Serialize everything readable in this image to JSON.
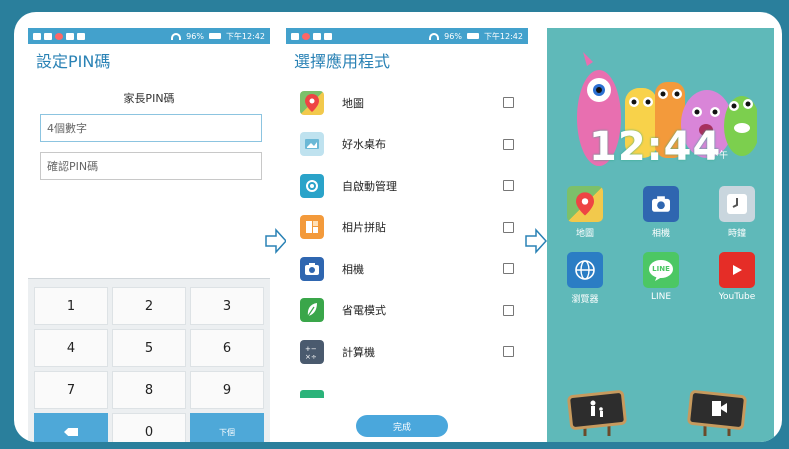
{
  "status_bar": {
    "battery": "96%",
    "time": "下午12:42"
  },
  "pin_screen": {
    "title": "設定PIN碼",
    "subtitle": "家長PIN碼",
    "pin_placeholder": "4個數字",
    "confirm_placeholder": "確認PIN碼",
    "keys": [
      "1",
      "2",
      "3",
      "4",
      "5",
      "6",
      "7",
      "8",
      "9",
      "",
      "0",
      "下個"
    ]
  },
  "app_select_screen": {
    "title": "選擇應用程式",
    "apps": [
      {
        "name": "地圖",
        "icon": "maps-icon"
      },
      {
        "name": "好水桌布",
        "icon": "wallpaper-icon"
      },
      {
        "name": "自啟動管理",
        "icon": "autostart-icon"
      },
      {
        "name": "相片拼貼",
        "icon": "collage-icon"
      },
      {
        "name": "相機",
        "icon": "camera-icon"
      },
      {
        "name": "省電模式",
        "icon": "power-saver-icon"
      },
      {
        "name": "計算機",
        "icon": "calculator-icon"
      }
    ],
    "done_label": "完成"
  },
  "home_screen": {
    "clock": "12:44",
    "period": "下午",
    "apps": [
      {
        "name": "地圖",
        "icon": "maps-icon"
      },
      {
        "name": "相機",
        "icon": "camera-icon"
      },
      {
        "name": "時鐘",
        "icon": "clock-icon"
      },
      {
        "name": "瀏覽器",
        "icon": "browser-icon"
      },
      {
        "name": "LINE",
        "icon": "line-icon"
      },
      {
        "name": "YouTube",
        "icon": "youtube-icon"
      }
    ],
    "line_logo_text": "LINE"
  },
  "colors": {
    "background": "#2a7f9c",
    "accent": "#43a1cc",
    "home_bg": "#5fb9b9"
  }
}
